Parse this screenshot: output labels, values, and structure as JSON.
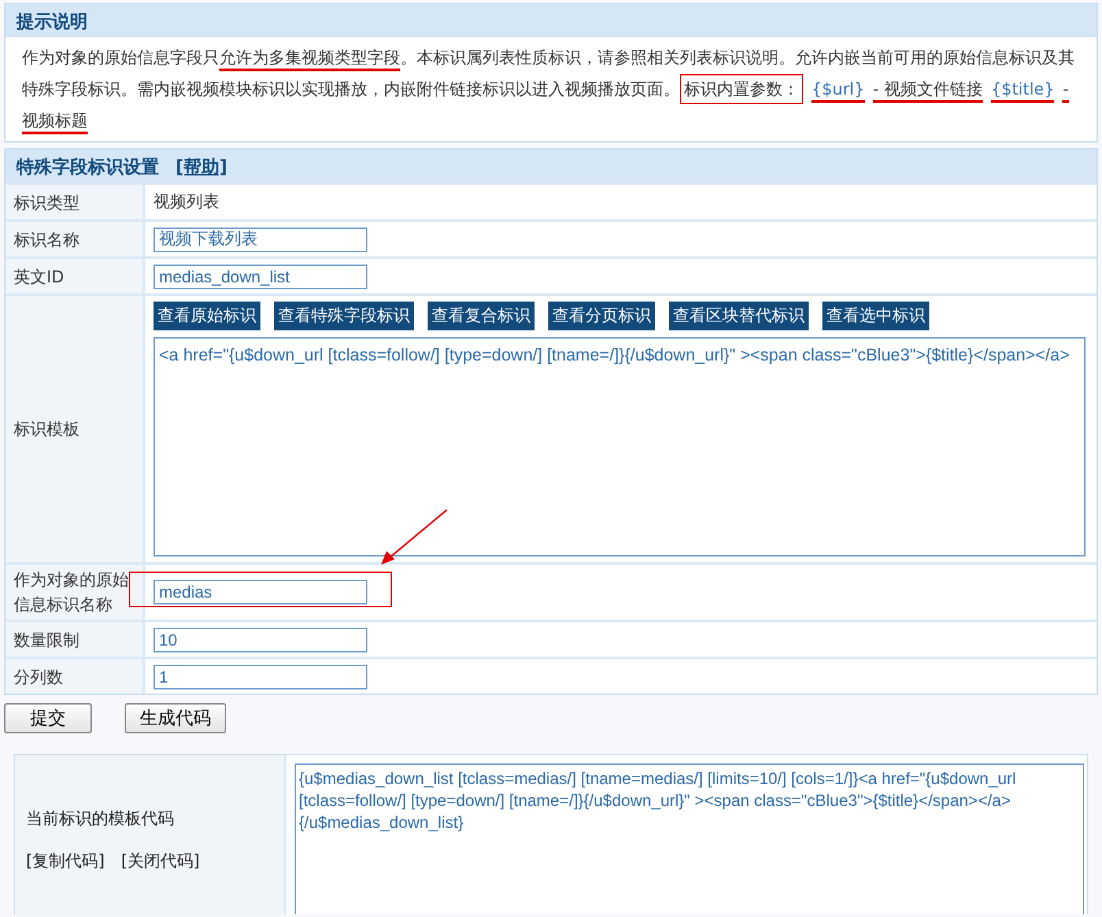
{
  "notice": {
    "title": "提示说明",
    "parts": [
      {
        "kind": "plain",
        "text": "作为对象的原始信息字段只"
      },
      {
        "kind": "underlined",
        "text": "允许为多集视频类型字段"
      },
      {
        "kind": "plain",
        "text": "。本标识属列表性质标识，请参照相关列表标识说明。允许内嵌当前可用的原始信息标识及其特殊字段标识。需内嵌视频模块标识以实现播放，内嵌附件链接标识以进入视频播放页面。"
      },
      {
        "kind": "boxed",
        "text": "标识内置参数："
      },
      {
        "kind": "link",
        "text": "{$url}"
      },
      {
        "kind": "underlined",
        "text": "- 视频文件链接"
      },
      {
        "kind": "link",
        "text": "{$title}"
      },
      {
        "kind": "underlined",
        "text": "- 视频标题"
      }
    ]
  },
  "settings": {
    "title": "特殊字段标识设置",
    "help_link": "[帮助]",
    "rows": [
      {
        "kind": "text",
        "label": "标识类型",
        "value": "视频列表"
      },
      {
        "kind": "input",
        "label": "标识名称",
        "value": "视频下载列表",
        "highlighted": false
      },
      {
        "kind": "input",
        "label": "英文ID",
        "value": "medias_down_list",
        "highlighted": false
      },
      {
        "kind": "template",
        "label": "标识模板",
        "buttons": [
          "查看原始标识",
          "查看特殊字段标识",
          "查看复合标识",
          "查看分页标识",
          "查看区块替代标识",
          "查看选中标识"
        ],
        "value": "<a href=\"{u$down_url [tclass=follow/] [type=down/] [tname=/]}{/u$down_url}\" ><span class=\"cBlue3\">{$title}</span></a>"
      },
      {
        "kind": "input",
        "label": "作为对象的原始信息标识名称",
        "value": "medias",
        "highlighted": true
      },
      {
        "kind": "input",
        "label": "数量限制",
        "value": "10",
        "highlighted": false
      },
      {
        "kind": "input",
        "label": "分列数",
        "value": "1",
        "highlighted": false
      }
    ]
  },
  "actions": [
    "提交",
    "生成代码"
  ],
  "code_panel": {
    "label": "当前标识的模板代码",
    "links": [
      "[复制代码]",
      "[关闭代码]"
    ],
    "code": "{u$medias_down_list [tclass=medias/] [tname=medias/] [limits=10/] [cols=1/]}<a href=\"{u$down_url [tclass=follow/] [type=down/] [tname=/]}{/u$down_url}\" ><span class=\"cBlue3\">{$title}</span></a>{/u$medias_down_list}"
  }
}
